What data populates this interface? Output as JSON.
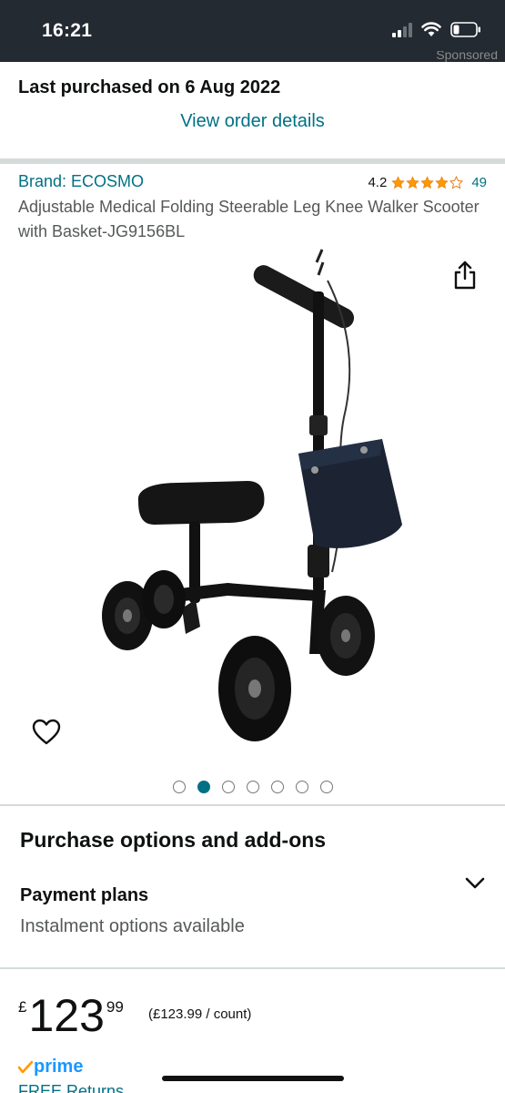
{
  "status_bar": {
    "time": "16:21"
  },
  "ad": {
    "sponsored_label": "Sponsored"
  },
  "purchase_history": {
    "last_purchased": "Last purchased on 6 Aug 2022",
    "view_order_link": "View order details"
  },
  "product": {
    "brand": "Brand: ECOSMO",
    "rating_value": "4.2",
    "rating_stars": 4.2,
    "rating_count": "49",
    "title": "Adjustable Medical Folding Steerable Leg Knee Walker Scooter with Basket-JG9156BL",
    "image_count": 7,
    "active_image_index": 1
  },
  "purchase_options": {
    "heading": "Purchase options and add-ons",
    "payment_plans_label": "Payment plans",
    "instalment_text": "Instalment options available"
  },
  "price": {
    "currency_symbol": "£",
    "whole": "123",
    "fraction": "99",
    "unit_price": "(£123.99 / count)"
  },
  "delivery": {
    "prime_label": "prime",
    "free_returns": "FREE Returns"
  },
  "colors": {
    "link": "#007185",
    "star": "#ff9900",
    "prime_blue": "#1a98ff",
    "status_bar_bg": "#232a31"
  },
  "icons": {
    "share": "share-icon",
    "wishlist": "heart-icon",
    "expand": "chevron-down-icon"
  }
}
